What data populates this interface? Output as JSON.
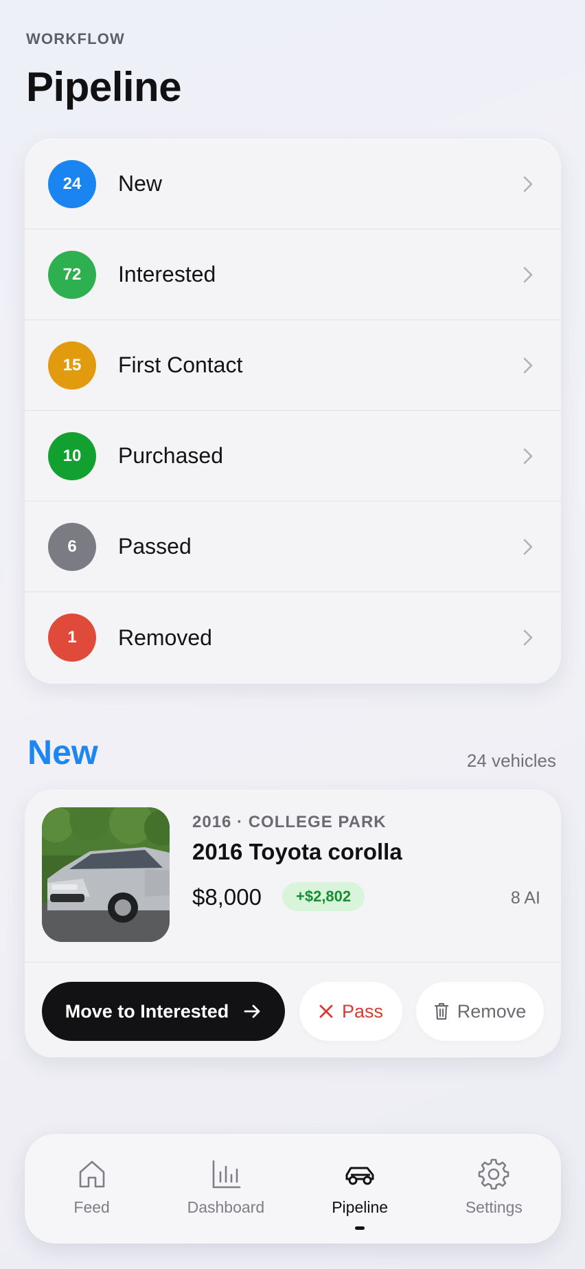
{
  "header": {
    "eyebrow": "WORKFLOW",
    "title": "Pipeline"
  },
  "stages": [
    {
      "count": "24",
      "label": "New",
      "color": "#1a85f0"
    },
    {
      "count": "72",
      "label": "Interested",
      "color": "#2eb050"
    },
    {
      "count": "15",
      "label": "First Contact",
      "color": "#e29a0e"
    },
    {
      "count": "10",
      "label": "Purchased",
      "color": "#12a030"
    },
    {
      "count": "6",
      "label": "Passed",
      "color": "#7b7b84"
    },
    {
      "count": "1",
      "label": "Removed",
      "color": "#e04a3a"
    }
  ],
  "section": {
    "title": "New",
    "count": "24 vehicles"
  },
  "vehicle": {
    "meta": "2016 · COLLEGE PARK",
    "name": "2016 Toyota corolla",
    "price": "$8,000",
    "delta": "+$2,802",
    "ai": "8 AI"
  },
  "actions": {
    "primary": "Move to Interested",
    "pass": "Pass",
    "remove": "Remove"
  },
  "tabs": [
    {
      "label": "Feed",
      "icon": "home-icon"
    },
    {
      "label": "Dashboard",
      "icon": "bar-chart-icon"
    },
    {
      "label": "Pipeline",
      "icon": "car-icon",
      "active": true
    },
    {
      "label": "Settings",
      "icon": "gear-icon"
    }
  ]
}
